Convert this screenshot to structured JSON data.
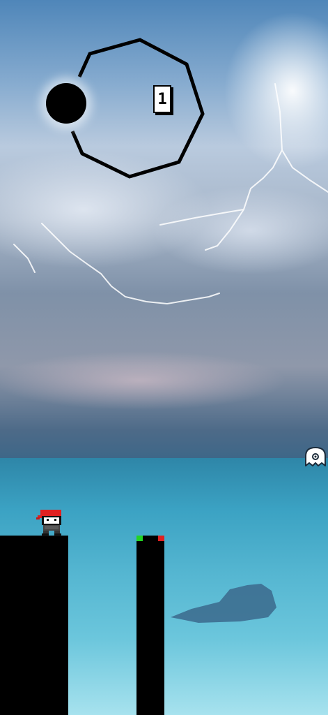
{
  "game": {
    "score": "1",
    "colors": {
      "platform": "#000000",
      "perfect_marker": "#22d422",
      "edge_marker": "#e02020",
      "hero_bandana": "#e02020"
    },
    "icons": {
      "timer": "octagon-timer-icon",
      "hero": "ninja-character-icon",
      "ghost": "ghost-icon"
    }
  }
}
